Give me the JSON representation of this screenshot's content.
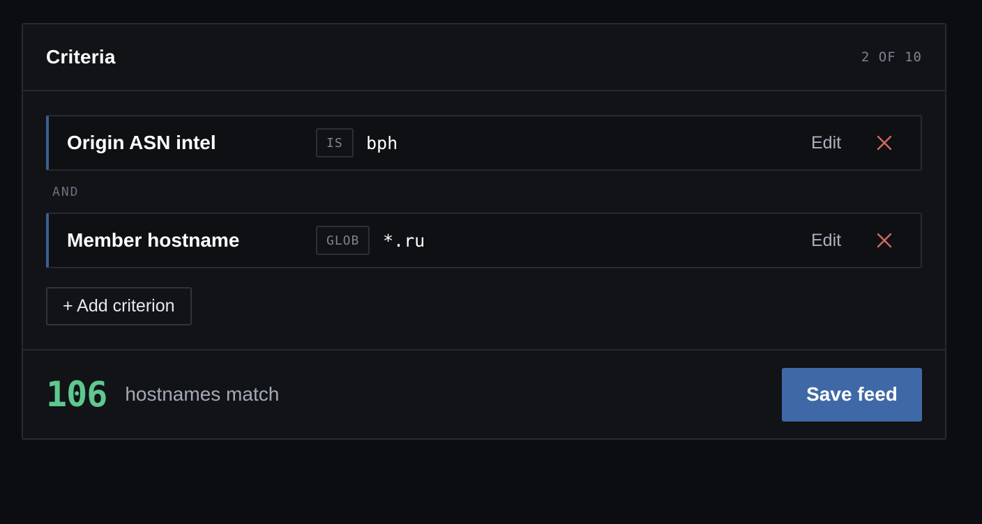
{
  "panel": {
    "title": "Criteria",
    "counter": "2 OF 10"
  },
  "criteria": [
    {
      "name": "Origin ASN intel",
      "operator": "IS",
      "value": "bph",
      "edit_label": "Edit",
      "remove_icon": "close-icon"
    },
    {
      "name": "Member hostname",
      "operator": "GLOB",
      "value": "*.ru",
      "edit_label": "Edit",
      "remove_icon": "close-icon"
    }
  ],
  "joiner": "AND",
  "add_button_label": "+ Add criterion",
  "footer": {
    "match_count": "106",
    "match_label": "hostnames match",
    "save_label": "Save feed"
  },
  "colors": {
    "accent": "#3f69a6",
    "match_count": "#5ec88f",
    "remove": "#d06a60",
    "rule_bar": "#3d5f93"
  }
}
